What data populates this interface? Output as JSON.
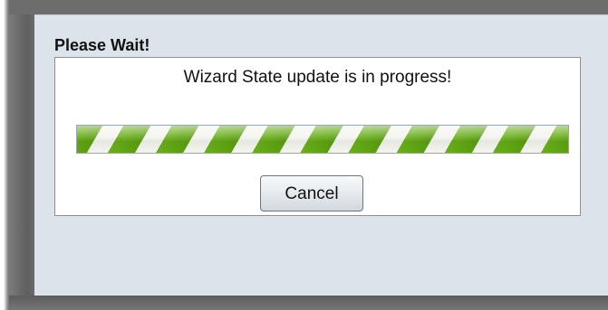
{
  "dialog": {
    "title": "Please Wait!",
    "message": "Wizard State update is in progress!",
    "progress_fraction": 1.0,
    "cancel_label": "Cancel"
  },
  "colors": {
    "dialog_background": "#dde3ea",
    "progress_green": "#5a9f0f",
    "progress_light": "#f3f4ee"
  }
}
